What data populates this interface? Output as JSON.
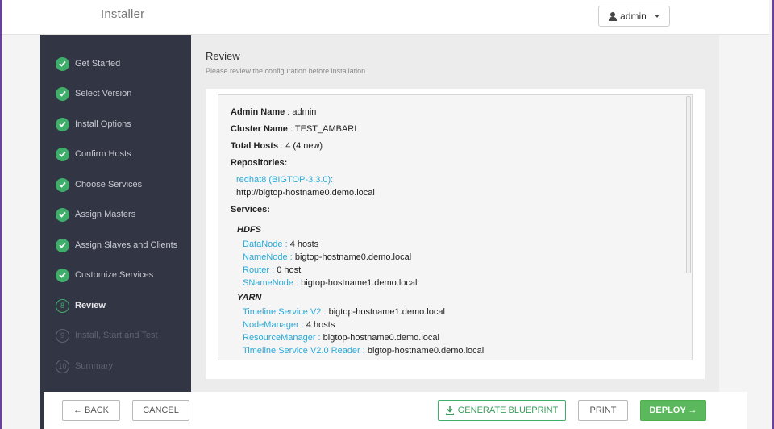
{
  "app": {
    "title": "Installer"
  },
  "user_menu": {
    "label": "admin"
  },
  "steps": [
    {
      "num": "1",
      "label": "Get Started",
      "state": "done"
    },
    {
      "num": "2",
      "label": "Select Version",
      "state": "done"
    },
    {
      "num": "3",
      "label": "Install Options",
      "state": "done"
    },
    {
      "num": "4",
      "label": "Confirm Hosts",
      "state": "done"
    },
    {
      "num": "5",
      "label": "Choose Services",
      "state": "done"
    },
    {
      "num": "6",
      "label": "Assign Masters",
      "state": "done"
    },
    {
      "num": "7",
      "label": "Assign Slaves and Clients",
      "state": "done"
    },
    {
      "num": "8",
      "label": "Customize Services",
      "state": "done"
    },
    {
      "num": "8",
      "label": "Review",
      "state": "current"
    },
    {
      "num": "9",
      "label": "Install, Start and Test",
      "state": "todo"
    },
    {
      "num": "10",
      "label": "Summary",
      "state": "todo"
    }
  ],
  "page": {
    "title": "Review",
    "subtitle": "Please review the configuration before installation"
  },
  "review": {
    "admin_label": "Admin Name",
    "admin_value": " : admin",
    "cluster_label": "Cluster Name",
    "cluster_value": " : TEST_AMBARI",
    "hosts_label": "Total Hosts",
    "hosts_value": " : 4 (4 new)",
    "repos_label": "Repositories:",
    "repo_name": "redhat8 (BIGTOP-3.3.0):",
    "repo_url": "http://bigtop-hostname0.demo.local",
    "services_label": "Services:",
    "services": [
      {
        "name": "HDFS",
        "components": [
          {
            "name": "DataNode :",
            "value": " 4 hosts"
          },
          {
            "name": "NameNode :",
            "value": " bigtop-hostname0.demo.local"
          },
          {
            "name": "Router :",
            "value": " 0 host"
          },
          {
            "name": "SNameNode :",
            "value": " bigtop-hostname1.demo.local"
          }
        ]
      },
      {
        "name": "YARN",
        "components": [
          {
            "name": "Timeline Service V2 :",
            "value": " bigtop-hostname1.demo.local"
          },
          {
            "name": "NodeManager :",
            "value": " 4 hosts"
          },
          {
            "name": "ResourceManager :",
            "value": " bigtop-hostname0.demo.local"
          },
          {
            "name": "Timeline Service V2.0 Reader :",
            "value": " bigtop-hostname0.demo.local"
          }
        ]
      }
    ]
  },
  "footer": {
    "back": "← BACK",
    "cancel": "CANCEL",
    "blueprint": "GENERATE BLUEPRINT",
    "print": "PRINT",
    "deploy": "DEPLOY →"
  },
  "colors": {
    "accent_green": "#3fae6a",
    "link_blue": "#2aa9d8",
    "sidebar_bg": "#323544",
    "frame_purple": "#6b3fa0"
  }
}
